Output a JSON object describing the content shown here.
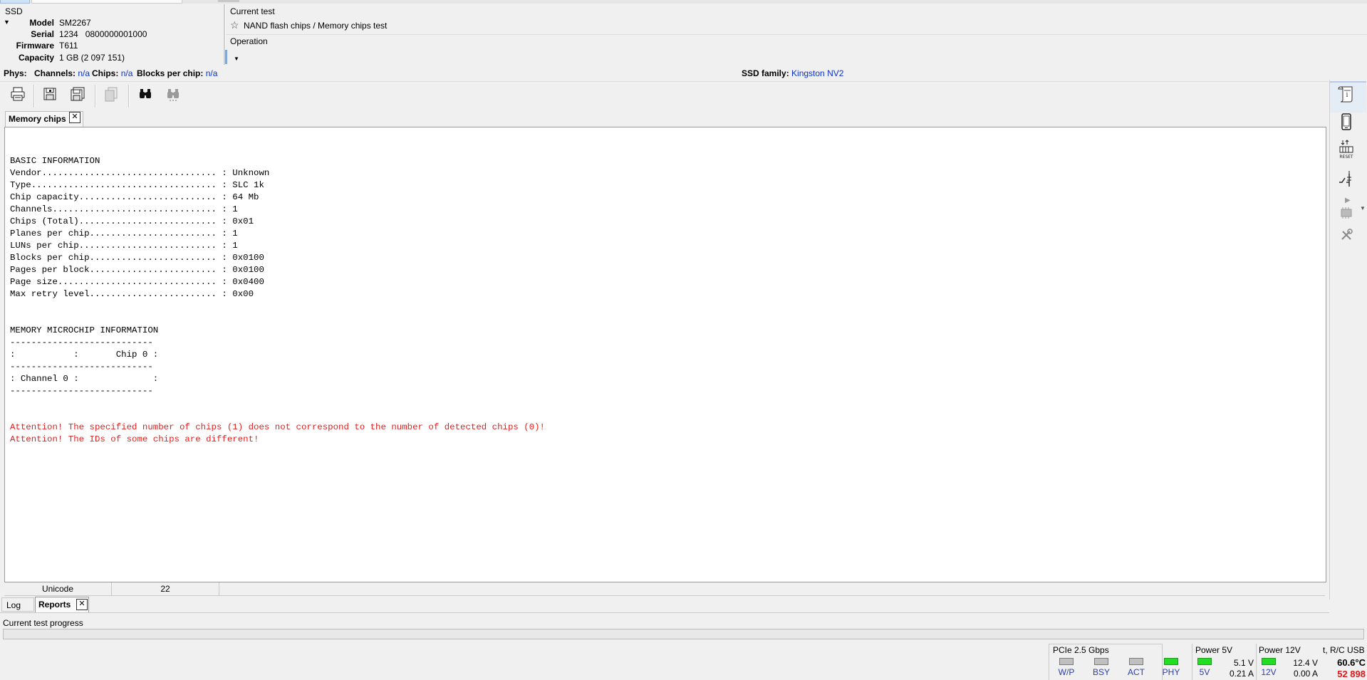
{
  "ssd": {
    "title": "SSD",
    "model_label": "Model",
    "model": "SM2267",
    "serial_label": "Serial",
    "serial": "1234   0800000001000",
    "firmware_label": "Firmware",
    "firmware": "T611",
    "capacity_label": "Capacity",
    "capacity": "1 GB (2 097 151)"
  },
  "current_test": {
    "label": "Current test",
    "value": "NAND flash chips / Memory chips test",
    "operation_label": "Operation"
  },
  "phys": {
    "label": "Phys:",
    "channels_label": "Channels:",
    "channels": "n/a",
    "chips_label": "Chips:",
    "chips": "n/a",
    "blocks_label": "Blocks per chip:",
    "blocks": "n/a",
    "family_label": "SSD family:",
    "family": "Kingston NV2"
  },
  "toolbar": {
    "icons": [
      "print-icon",
      "save-icon",
      "save-all-icon",
      "copy-icon",
      "find-icon",
      "find-next-icon"
    ]
  },
  "document_tab": {
    "label": "Memory chips"
  },
  "report": {
    "lines": [
      "BASIC INFORMATION",
      "Vendor................................. : Unknown",
      "Type................................... : SLC 1k",
      "Chip capacity.......................... : 64 Mb",
      "Channels............................... : 1",
      "Chips (Total).......................... : 0x01",
      "Planes per chip........................ : 1",
      "LUNs per chip.......................... : 1",
      "Blocks per chip........................ : 0x0100",
      "Pages per block........................ : 0x0100",
      "Page size.............................. : 0x0400",
      "Max retry level........................ : 0x00",
      "",
      "",
      "MEMORY MICROCHIP INFORMATION",
      "---------------------------",
      ":           :       Chip 0 :",
      "---------------------------",
      ": Channel 0 :              :",
      "---------------------------"
    ],
    "warnings": [
      "Attention! The specified number of chips (1) does not correspond to the number of detected chips (0)!",
      "Attention! The IDs of some chips are different!"
    ],
    "warning_color": "#e31f1f"
  },
  "doc_status": {
    "encoding": "Unicode",
    "count": "22"
  },
  "bottom_tabs": {
    "log": "Log",
    "reports": "Reports"
  },
  "progress": {
    "label": "Current test progress",
    "value": 0
  },
  "indicators": {
    "title": "PCIe 2.5 Gbps",
    "leds": [
      {
        "label": "W/P",
        "state": "off"
      },
      {
        "label": "BSY",
        "state": "off"
      },
      {
        "label": "ACT",
        "state": "off"
      },
      {
        "label": "PHY",
        "state": "on"
      }
    ]
  },
  "power5": {
    "title": "Power 5V",
    "led_label": "5V",
    "voltage": "5.1 V",
    "current": "0.21 A"
  },
  "power12": {
    "title": "Power 12V",
    "led_label": "12V",
    "voltage": "12.4 V",
    "current": "0.00 A"
  },
  "temperature": {
    "label": "t, R/C USB",
    "value": "60.6°C",
    "rc": "52 898"
  }
}
